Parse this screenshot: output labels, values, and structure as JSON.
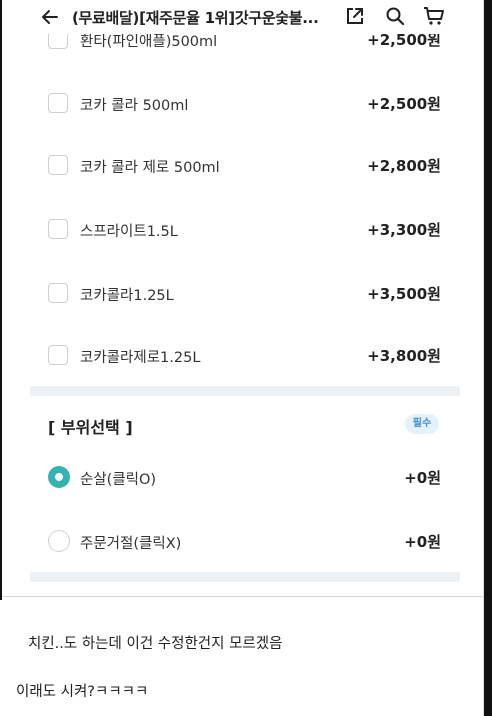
{
  "header": {
    "title": "(무료배달)[재주문율 1위]갓구운숯불...",
    "icons": [
      "back-arrow-icon",
      "share-icon",
      "search-icon",
      "cart-icon"
    ]
  },
  "drink_options": [
    {
      "label": "환타(파인애플)500ml",
      "price": "+2,500원"
    },
    {
      "label": "코카 콜라 500ml",
      "price": "+2,500원"
    },
    {
      "label": "코카 콜라 제로 500ml",
      "price": "+2,800원"
    },
    {
      "label": "스프라이트1.5L",
      "price": "+3,300원"
    },
    {
      "label": "코카콜라1.25L",
      "price": "+3,500원"
    },
    {
      "label": "코카콜라제로1.25L",
      "price": "+3,800원"
    }
  ],
  "part_section": {
    "title": "[ 부위선택 ]",
    "badge": "필수",
    "options": [
      {
        "label": "순살(클릭O)",
        "price": "+0원",
        "selected": true
      },
      {
        "label": "주문거절(클릭X)",
        "price": "+0원",
        "selected": false
      }
    ]
  },
  "comments": [
    "치킨..도 하는데 이건 수정한건지 모르겠음",
    "이래도 시켜?ㅋㅋㅋㅋ"
  ],
  "colors": {
    "accent_teal": "#36b3b0",
    "badge_bg": "#e5f2fb",
    "badge_text": "#3f8fd0"
  }
}
